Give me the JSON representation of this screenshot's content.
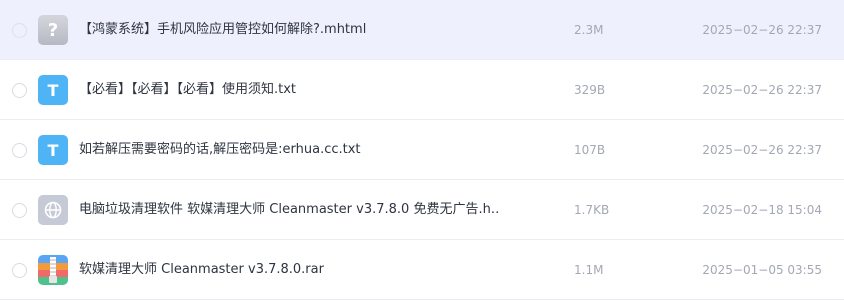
{
  "files": [
    {
      "name": "【鸿蒙系统】手机风险应用管控如何解除?.mhtml",
      "size": "2.3M",
      "date": "2025−02−26 22:37",
      "icon": "unknown-file-icon",
      "icon_glyph": "?",
      "selected": true
    },
    {
      "name": "【必看】【必看】【必看】使用须知.txt",
      "size": "329B",
      "date": "2025−02−26 22:37",
      "icon": "text-file-icon",
      "icon_glyph": "T",
      "selected": false
    },
    {
      "name": "如若解压需要密码的话,解压密码是:erhua.cc.txt",
      "size": "107B",
      "date": "2025−02−26 22:37",
      "icon": "text-file-icon",
      "icon_glyph": "T",
      "selected": false
    },
    {
      "name": "电脑垃圾清理软件 软媒清理大师 Cleanmaster v3.7.8.0 免费无广告.h…",
      "size": "1.7KB",
      "date": "2025−02−18 15:04",
      "icon": "web-file-icon",
      "icon_glyph": "",
      "selected": false
    },
    {
      "name": "软媒清理大师 Cleanmaster v3.7.8.0.rar",
      "size": "1.1M",
      "date": "2025−01−05 03:55",
      "icon": "archive-file-icon",
      "icon_glyph": "",
      "selected": false
    }
  ],
  "colors": {
    "selected_row_bg": "#eef1fd",
    "text_icon_bg": "#4fb4f5",
    "meta_text": "#a3a8b3",
    "row_divider": "#ebedf2"
  }
}
